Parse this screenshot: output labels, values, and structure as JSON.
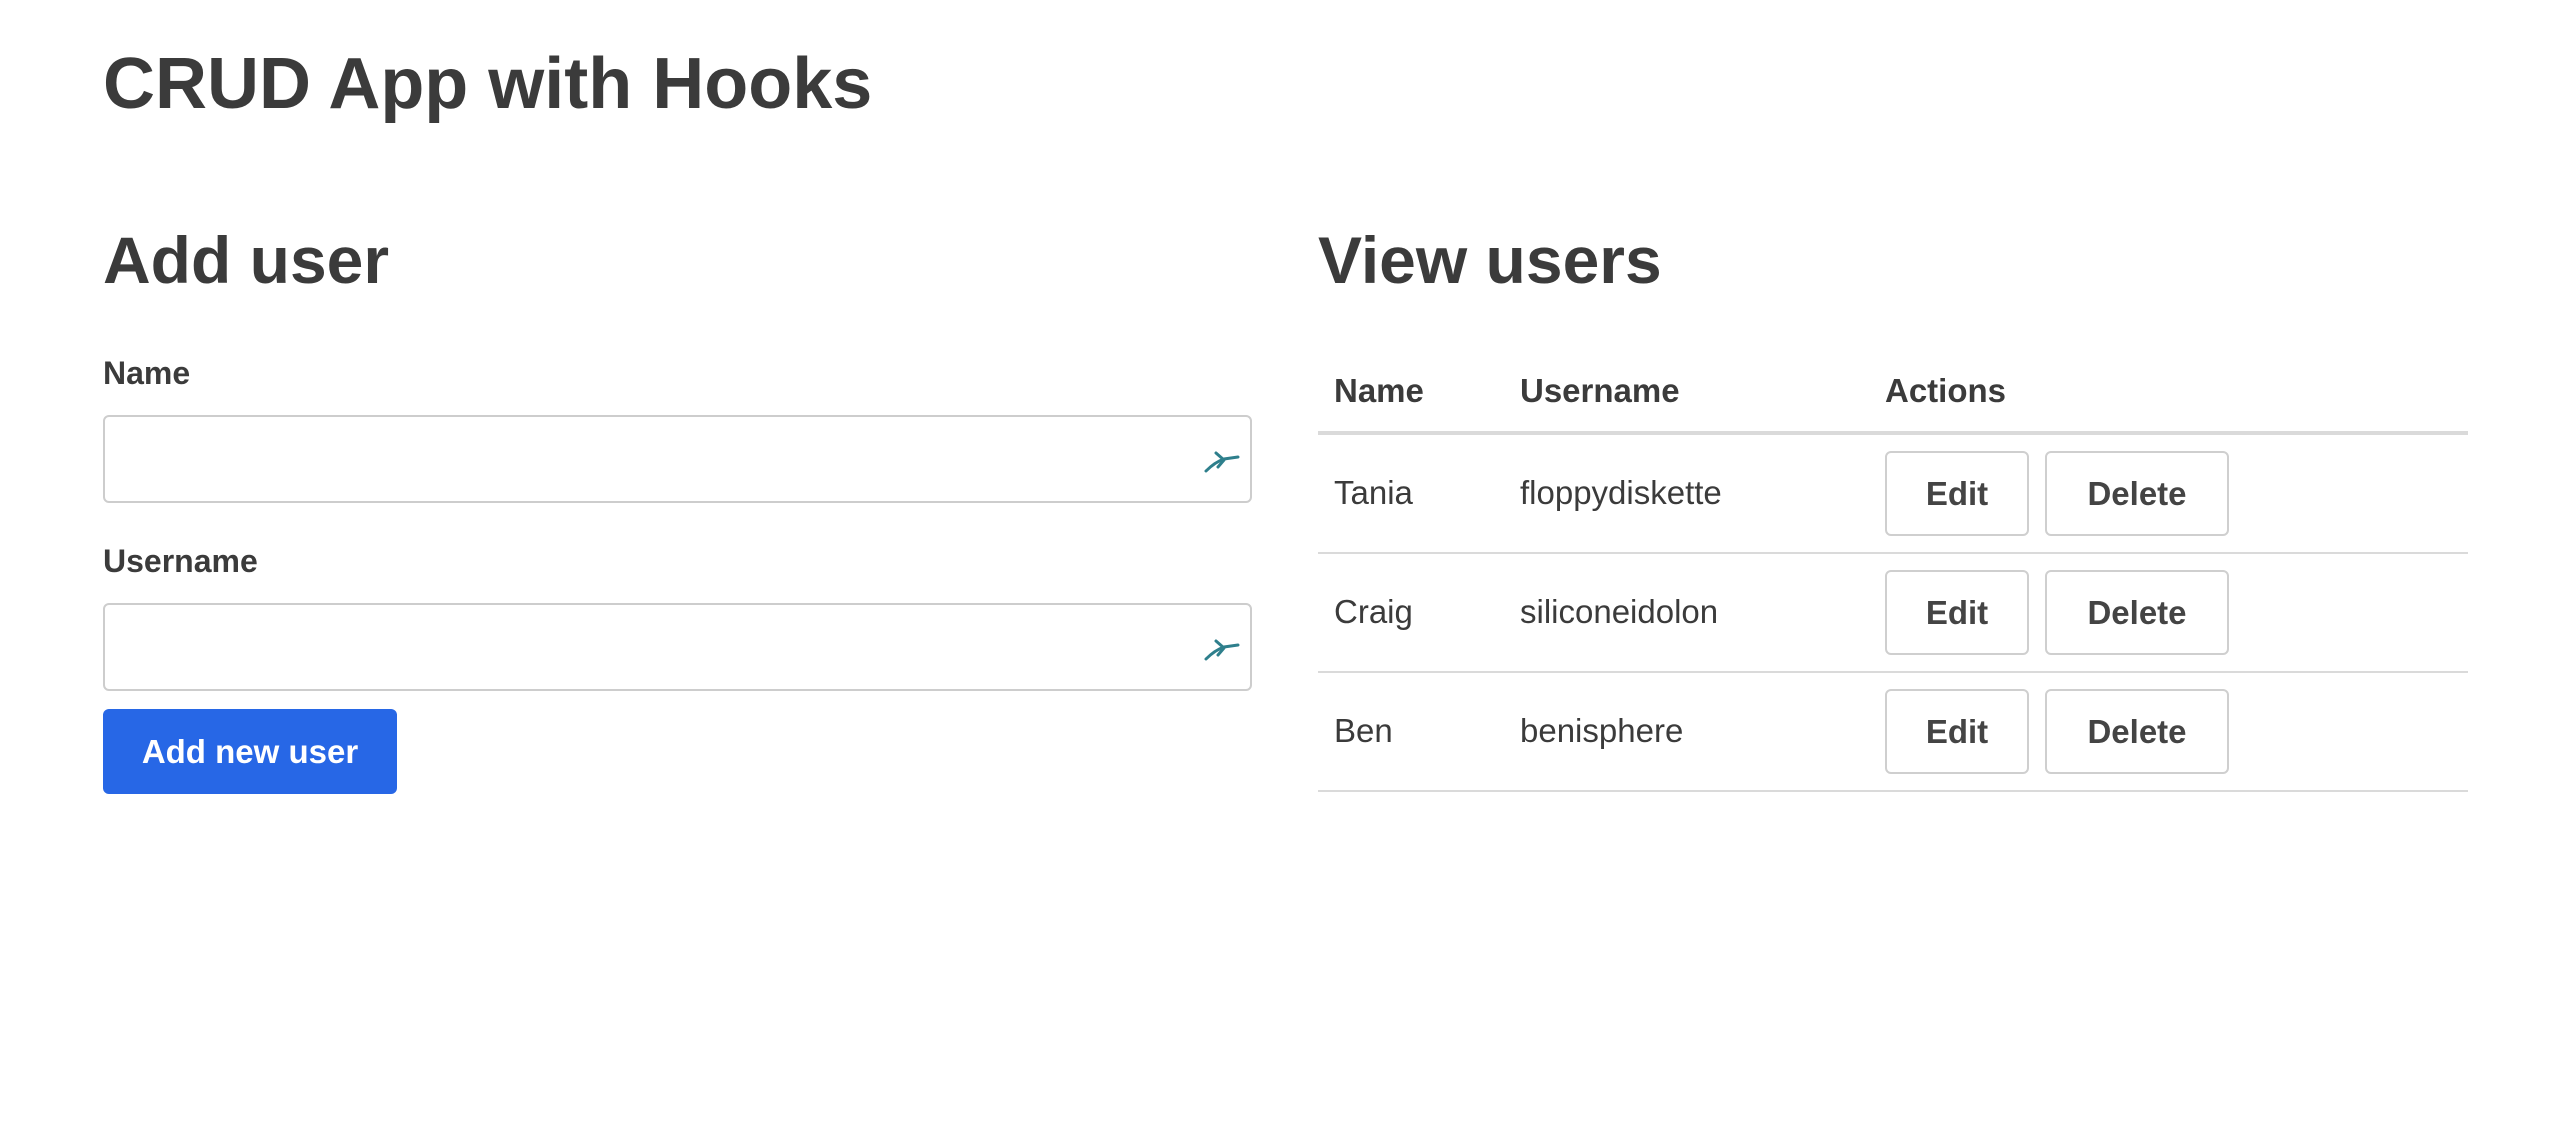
{
  "app": {
    "title": "CRUD App with Hooks"
  },
  "add_user": {
    "title": "Add user",
    "name_label": "Name",
    "name_value": "",
    "username_label": "Username",
    "username_value": "",
    "field_icon": "password-manager-bird-icon",
    "submit_label": "Add new user"
  },
  "view_users": {
    "title": "View users",
    "columns": [
      "Name",
      "Username",
      "Actions"
    ],
    "rows": [
      {
        "name": "Tania",
        "username": "floppydiskette",
        "edit_label": "Edit",
        "delete_label": "Delete"
      },
      {
        "name": "Craig",
        "username": "siliconeidolon",
        "edit_label": "Edit",
        "delete_label": "Delete"
      },
      {
        "name": "Ben",
        "username": "benisphere",
        "edit_label": "Edit",
        "delete_label": "Delete"
      }
    ]
  },
  "colors": {
    "primary": "#2767e6",
    "text": "#3b3b3b",
    "border": "#cdcdcd",
    "icon": "#2e7f8c"
  }
}
